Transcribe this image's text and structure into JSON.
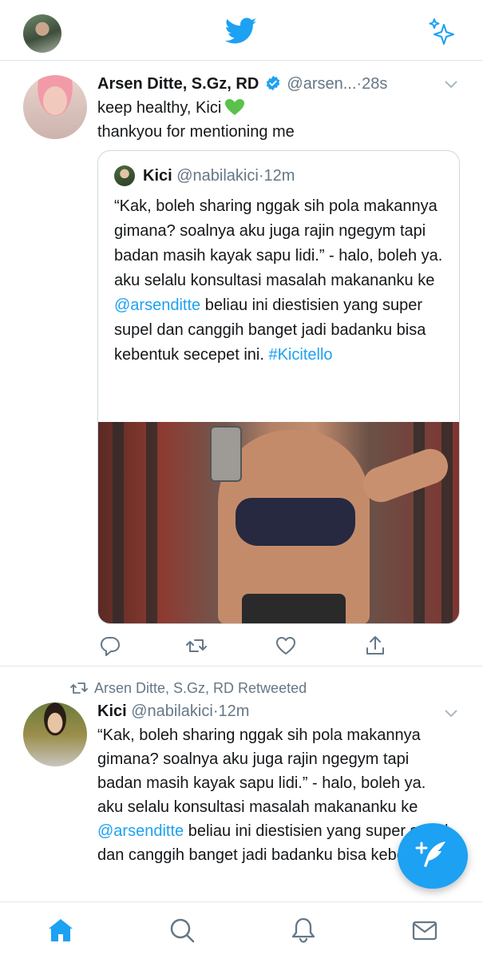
{
  "header": {
    "avatar_icon": "profile-avatar",
    "logo_icon": "twitter-bird-icon",
    "sparkle_icon": "sparkle-icon",
    "accent_color": "#1DA1F2"
  },
  "tweet1": {
    "name": "Arsen Ditte, S.Gz, RD",
    "handle": "@arsen...",
    "dot": "·",
    "time": "28s",
    "line1": "keep healthy, Kici",
    "line2": "thankyou for mentioning me",
    "quote": {
      "name": "Kici",
      "handle": "@nabilakici",
      "dot": "·",
      "time": "12m",
      "text_before": "“Kak, boleh sharing nggak sih pola makannya gimana? soalnya aku juga rajin ngegym tapi badan masih kayak sapu lidi.” - halo, boleh ya. aku selalu konsultasi masalah makananku ke ",
      "mention": "@arsenditte",
      "text_after": " beliau ini diestisien yang super supel dan canggih banget jadi badanku bisa kebentuk secepet ini. ",
      "hashtag": "#Kicitello"
    }
  },
  "tweet2": {
    "retweeted_by": "Arsen Ditte, S.Gz, RD Retweeted",
    "name": "Kici",
    "handle": "@nabilakici",
    "dot": "·",
    "time": "12m",
    "text_before": "“Kak, boleh sharing nggak sih pola makannya gimana? soalnya aku juga rajin ngegym tapi badan masih kayak sapu lidi.” - halo, boleh ya. aku selalu konsultasi masalah makananku ke ",
    "mention": "@arsenditte",
    "text_after": " beliau ini diestisien yang super supel dan canggih banget jadi badanku bisa kebentuk"
  },
  "nav": {
    "items": [
      "home-icon",
      "search-icon",
      "notifications-icon",
      "messages-icon"
    ]
  }
}
